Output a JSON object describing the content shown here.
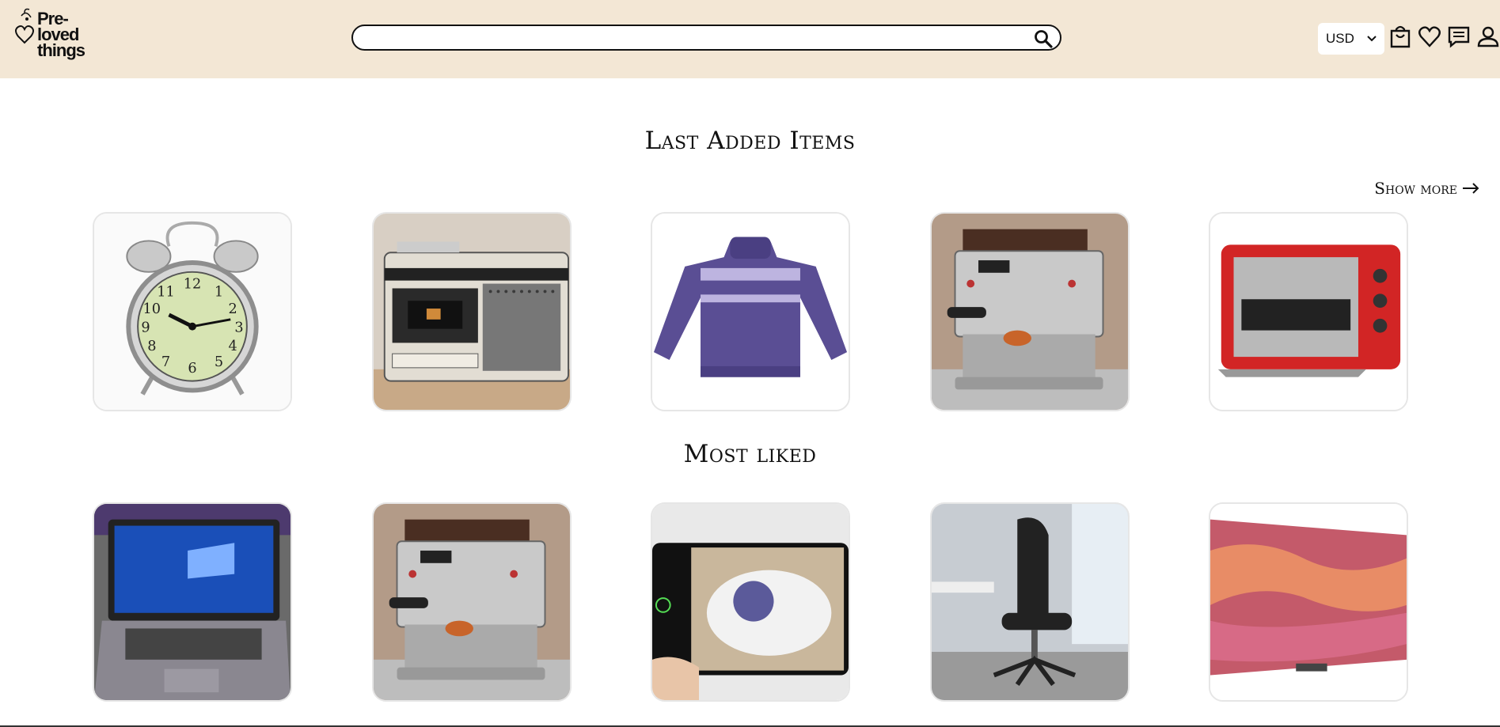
{
  "header": {
    "logo_lines": [
      "Pre-",
      "loved",
      "things"
    ],
    "search": {
      "value": "",
      "placeholder": ""
    },
    "currency": {
      "selected": "USD"
    },
    "icons": [
      "search-icon",
      "shopping-bag-icon",
      "heart-icon",
      "chat-icon",
      "user-icon"
    ]
  },
  "colors": {
    "header_bg": "#f3e7d5",
    "accent": "#111111"
  },
  "sections": {
    "last_added": {
      "title": "Last Added Items",
      "show_more": "Show more",
      "items": [
        "alarm-clock",
        "cassette-radio",
        "purple-sweater",
        "espresso-machine",
        "red-toaster-oven"
      ]
    },
    "most_liked": {
      "title": "Most liked",
      "items": [
        "laptop",
        "espresso-machine",
        "phone-camera",
        "office-chair",
        "television"
      ]
    }
  }
}
